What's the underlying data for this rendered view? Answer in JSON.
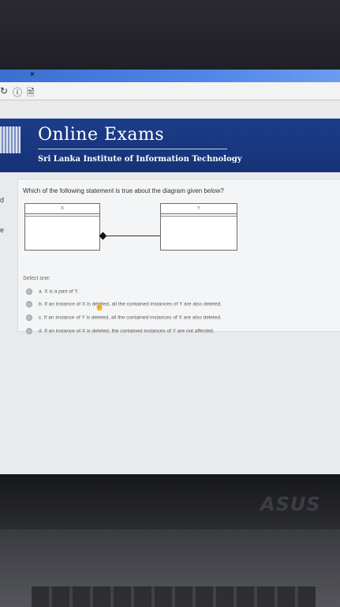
{
  "window": {
    "close_glyph": "×"
  },
  "header": {
    "title": "Online Exams",
    "subtitle": "Sri Lanka Institute of Information Technology",
    "logo_text": "IIT",
    "bg_color": "#1c3d8a"
  },
  "left_strip": {
    "label_top": "d",
    "label_mid": "e"
  },
  "question": {
    "text": "Which of the following statement is true about the diagram given below?",
    "diagram": {
      "class_left": "X",
      "class_right": "Y"
    },
    "select_label": "Select one:",
    "options": [
      "a. X is a part of Y.",
      "b. If an instance of X is deleted, all the contained instances of Y are also deleted.",
      "c. If an instance of Y is deleted, all the contained instances of X are also deleted.",
      "d. If an instance of X is deleted, the contained instances of Y are not affected."
    ]
  },
  "device": {
    "brand": "ASUS"
  }
}
